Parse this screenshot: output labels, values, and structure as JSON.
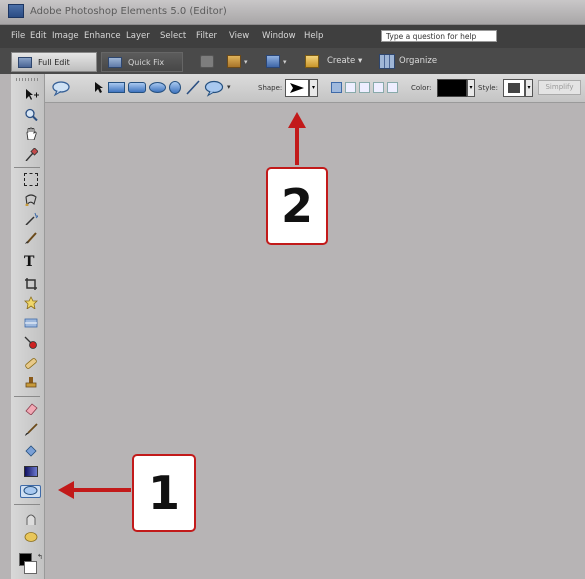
{
  "window": {
    "title": "Adobe Photoshop Elements 5.0 (Editor)"
  },
  "menu": {
    "items": [
      "File",
      "Edit",
      "Image",
      "Enhance",
      "Layer",
      "Select",
      "Filter",
      "View",
      "Window",
      "Help"
    ],
    "help_placeholder": "Type a question for help"
  },
  "modebar": {
    "full_edit": "Full Edit",
    "quick_fix": "Quick Fix",
    "create": "Create",
    "organize": "Organize"
  },
  "options": {
    "shape_label": "Shape:",
    "color_label": "Color:",
    "style_label": "Style:",
    "simplify_label": "Simplify",
    "color_value": "#000000"
  },
  "annotations": {
    "callout_1": "1",
    "callout_2": "2",
    "color": "#c21a1a"
  },
  "colors": {
    "workspace": "#b7b4b5",
    "menubar": "#3f3f3f",
    "modebar": "#4a4a4a"
  },
  "icons": [
    "photoshop-logo-icon",
    "full-edit-icon",
    "quick-fix-icon",
    "print-icon",
    "share-icon",
    "create-icon",
    "organize-icon",
    "speech-bubble-shape-icon",
    "shape-selection-icon",
    "rectangle-shape-icon",
    "rounded-rectangle-shape-icon",
    "ellipse-shape-icon",
    "polygon-shape-icon",
    "line-shape-icon",
    "custom-shape-icon",
    "move-tool-icon",
    "zoom-tool-icon",
    "hand-tool-icon",
    "eyedropper-tool-icon",
    "marquee-tool-icon",
    "lasso-tool-icon",
    "magic-wand-tool-icon",
    "selection-brush-icon",
    "type-tool-icon",
    "crop-tool-icon",
    "cookie-cutter-tool-icon",
    "straighten-tool-icon",
    "red-eye-tool-icon",
    "spot-healing-tool-icon",
    "clone-stamp-tool-icon",
    "eraser-tool-icon",
    "brush-tool-icon",
    "paint-bucket-tool-icon",
    "gradient-tool-icon",
    "shape-tool-icon",
    "blur-tool-icon",
    "sponge-tool-icon",
    "arrow-icon"
  ]
}
